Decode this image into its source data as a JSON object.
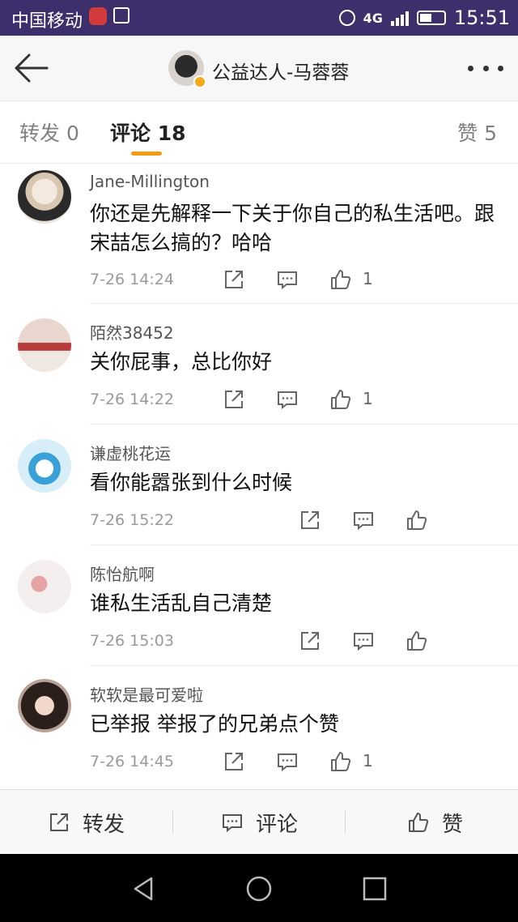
{
  "status_bar": {
    "carrier": "中国移动",
    "network": "4G",
    "time": "15:51",
    "icons": [
      "weibo-notification-icon",
      "image-icon",
      "alarm-icon",
      "signal-icon",
      "battery-icon"
    ]
  },
  "header": {
    "title": "公益达人-马蓉蓉",
    "back_icon": "arrow-left-icon",
    "more_icon": "more-dots-icon"
  },
  "tabs": [
    {
      "label": "转发 0",
      "active": false
    },
    {
      "label": "评论 18",
      "active": true
    },
    {
      "label": "赞 5",
      "active": false
    }
  ],
  "comments": [
    {
      "name": "Jane-Millington",
      "text": "你还是先解释一下关于你自己的私生活吧。跟宋喆怎么搞的？哈哈",
      "time": "7-26 14:24",
      "likes": "1"
    },
    {
      "name": "陌然38452",
      "text": "关你屁事，总比你好",
      "time": "7-26 14:22",
      "likes": "1"
    },
    {
      "name": "谦虚桃花运",
      "text": "看你能嚣张到什么时候",
      "time": "7-26 15:22",
      "likes": ""
    },
    {
      "name": "陈怡航啊",
      "text": "谁私生活乱自己清楚",
      "time": "7-26 15:03",
      "likes": ""
    },
    {
      "name": "软软是最可爱啦",
      "text": "已举报 举报了的兄弟点个赞",
      "time": "7-26 14:45",
      "likes": "1"
    }
  ],
  "toolbar": {
    "forward_label": "转发",
    "comment_label": "评论",
    "like_label": "赞"
  },
  "colors": {
    "status_bar": "#3d2f6b",
    "accent": "#f39c12",
    "text": "#111111",
    "muted": "#9a9a9a"
  }
}
